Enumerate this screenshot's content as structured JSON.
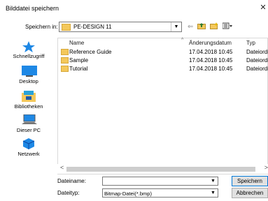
{
  "window": {
    "title": "Bilddatei speichern",
    "close_glyph": "✕"
  },
  "toolbar": {
    "lookin_label": "Speichern in:",
    "lookin_value": "PE-DESIGN 11",
    "icons": [
      "back-arrow-icon",
      "up-folder-icon",
      "new-folder-icon",
      "view-menu-icon"
    ]
  },
  "places": [
    {
      "label": "Schnellzugriff",
      "icon": "star-icon"
    },
    {
      "label": "Desktop",
      "icon": "desktop-icon"
    },
    {
      "label": "Bibliotheken",
      "icon": "libraries-icon"
    },
    {
      "label": "Dieser PC",
      "icon": "pc-icon"
    },
    {
      "label": "Netzwerk",
      "icon": "network-icon"
    }
  ],
  "columns": {
    "name": "Name",
    "date": "Änderungsdatum",
    "type": "Typ"
  },
  "files": [
    {
      "name": "Reference Guide",
      "date": "17.04.2018 10:45",
      "type": "Dateiordner"
    },
    {
      "name": "Sample",
      "date": "17.04.2018 10:45",
      "type": "Dateiordner"
    },
    {
      "name": "Tutorial",
      "date": "17.04.2018 10:45",
      "type": "Dateiordner"
    }
  ],
  "form": {
    "filename_label": "Dateiname:",
    "filename_value": "",
    "filetype_label": "Dateityp:",
    "filetype_value": "Bitmap-Datei(*.bmp)"
  },
  "buttons": {
    "save": "Speichern",
    "cancel": "Abbrechen"
  },
  "colors": {
    "folder": "#f4c85b",
    "accent": "#0078d7"
  }
}
